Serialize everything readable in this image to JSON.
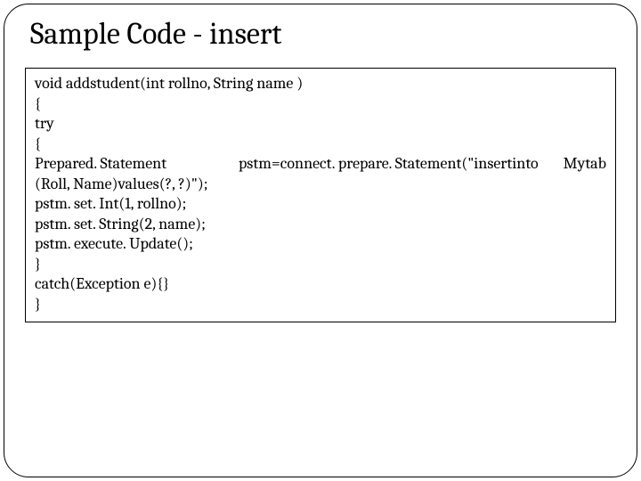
{
  "title": "Sample Code - insert",
  "code": {
    "l1": "void addstudent(int rollno, String name )",
    "l2": "{",
    "l3": "try",
    "l4": "{",
    "l5": {
      "left": "Prepared. Statement",
      "mid": "pstm=connect. prepare. Statement(\"insert",
      "w1": "into",
      "w2": "Mytab"
    },
    "l6": "(Roll, Name)values(?, ?)\");",
    "l7": "pstm. set. Int(1, rollno);",
    "l8": "pstm. set. String(2, name);",
    "l9": "pstm. execute. Update();",
    "l10": "}",
    "l11": "catch(Exception e){}",
    "l12": "}"
  }
}
